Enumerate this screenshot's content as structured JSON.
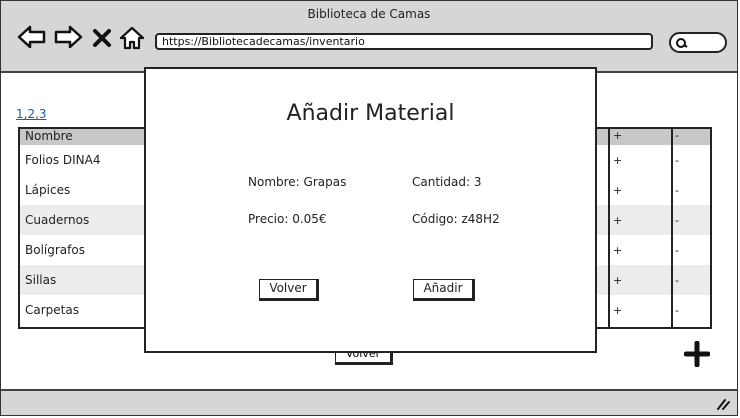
{
  "window": {
    "title": "Biblioteca de Camas"
  },
  "browser": {
    "url": "https://Bibliotecadecamas/inventario",
    "icons": [
      "back-arrow-icon",
      "forward-arrow-icon",
      "close-x-icon",
      "home-icon",
      "search-icon"
    ]
  },
  "pagination": "1,2,3",
  "table": {
    "header": "Nombre",
    "rows": [
      {
        "name": "Folios DINA4",
        "plus": "+",
        "minus": "-"
      },
      {
        "name": "Lápices",
        "plus": "+",
        "minus": "-"
      },
      {
        "name": "Cuadernos",
        "plus": "+",
        "minus": "-"
      },
      {
        "name": "Bolígrafos",
        "plus": "+",
        "minus": "-"
      },
      {
        "name": "Sillas",
        "plus": "+",
        "minus": "-"
      },
      {
        "name": "Carpetas",
        "plus": "+",
        "minus": "-"
      }
    ],
    "header_plus": "+",
    "header_minus": "-"
  },
  "background_button": "Volver",
  "modal": {
    "title": "Añadir Material",
    "nombre": "Nombre: Grapas",
    "cantidad": "Cantidad: 3",
    "precio": "Precio: 0.05€",
    "codigo": "Código: z48H2",
    "volver_label": "Volver",
    "anadir_label": "Añadir"
  }
}
